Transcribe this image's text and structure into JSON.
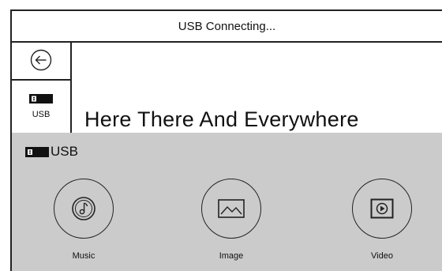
{
  "header": {
    "title": "USB Connecting..."
  },
  "sidebar": {
    "usb_label": "USB"
  },
  "now_playing": {
    "title": "Here There And Everywhere"
  },
  "source_panel": {
    "label": "USB",
    "items": [
      {
        "label": "Music",
        "icon": "music-disc-icon"
      },
      {
        "label": "Image",
        "icon": "image-icon"
      },
      {
        "label": "Video",
        "icon": "video-play-icon"
      }
    ]
  },
  "colors": {
    "panel_bg": "#cbcbcb",
    "line": "#222222",
    "background": "#ffffff"
  }
}
